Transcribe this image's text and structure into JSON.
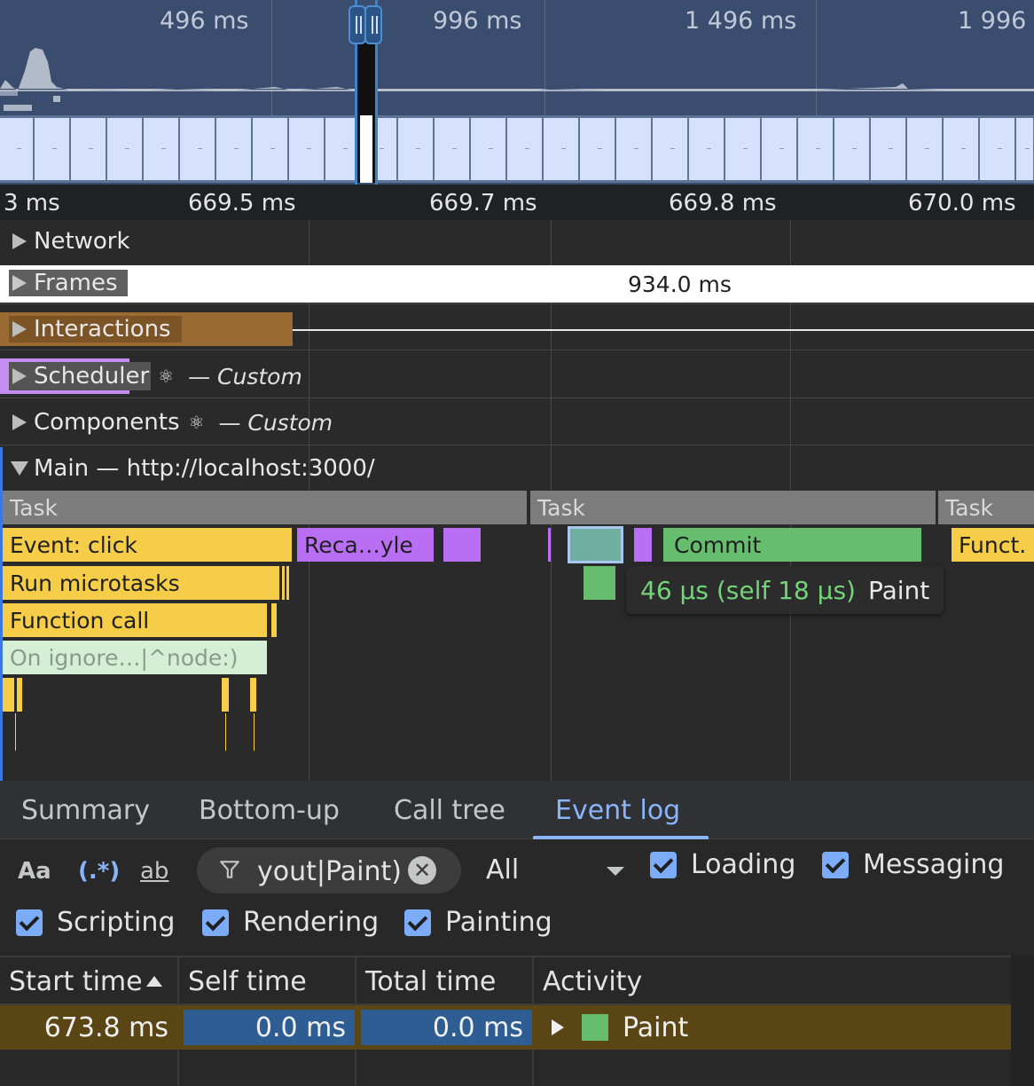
{
  "overview": {
    "time_labels": [
      "496 ms",
      "996 ms",
      "1 496 ms",
      "1 996"
    ]
  },
  "ruler": {
    "labels": [
      "3 ms",
      "669.5 ms",
      "669.7 ms",
      "669.8 ms",
      "670.0 ms"
    ]
  },
  "tracks": {
    "network": "Network",
    "frames": "Frames",
    "frames_duration": "934.0 ms",
    "interactions": "Interactions",
    "scheduler": "Scheduler",
    "scheduler_tag": "— Custom",
    "components": "Components",
    "components_tag": "— Custom",
    "main": "Main — http://localhost:3000/"
  },
  "flame": {
    "task_1": "Task",
    "task_2": "Task",
    "task_3": "Task",
    "event_click": "Event: click",
    "recalc_style": "Reca…yle",
    "commit": "Commit",
    "function_short": "Funct.",
    "run_microtasks": "Run microtasks",
    "function_call": "Function call",
    "on_ignore": "On ignore…|^node:)"
  },
  "tooltip": {
    "time": "46 µs (self 18 µs)",
    "name": "Paint"
  },
  "bottom_tabs": {
    "summary": "Summary",
    "bottom_up": "Bottom-up",
    "call_tree": "Call tree",
    "event_log": "Event log",
    "active": "Event log"
  },
  "toolbar": {
    "match_case": "Aa",
    "regex": "(.*)",
    "whole_word": "ab",
    "filter_value": "yout|Paint)",
    "level_value": "All",
    "checkboxes": {
      "loading": "Loading",
      "messaging": "Messaging",
      "scripting": "Scripting",
      "rendering": "Rendering",
      "painting": "Painting"
    }
  },
  "table": {
    "columns": {
      "start_time": "Start time",
      "self_time": "Self time",
      "total_time": "Total time",
      "activity": "Activity"
    },
    "rows": [
      {
        "start_time": "673.8 ms",
        "self_time": "0.0 ms",
        "total_time": "0.0 ms",
        "activity": "Paint"
      }
    ]
  },
  "colors": {
    "scripting": "#f5cd48",
    "rendering": "#b96ef4",
    "painting": "#65bd6d",
    "selected_row": "#5a4515",
    "accent": "#8ab4f8"
  }
}
